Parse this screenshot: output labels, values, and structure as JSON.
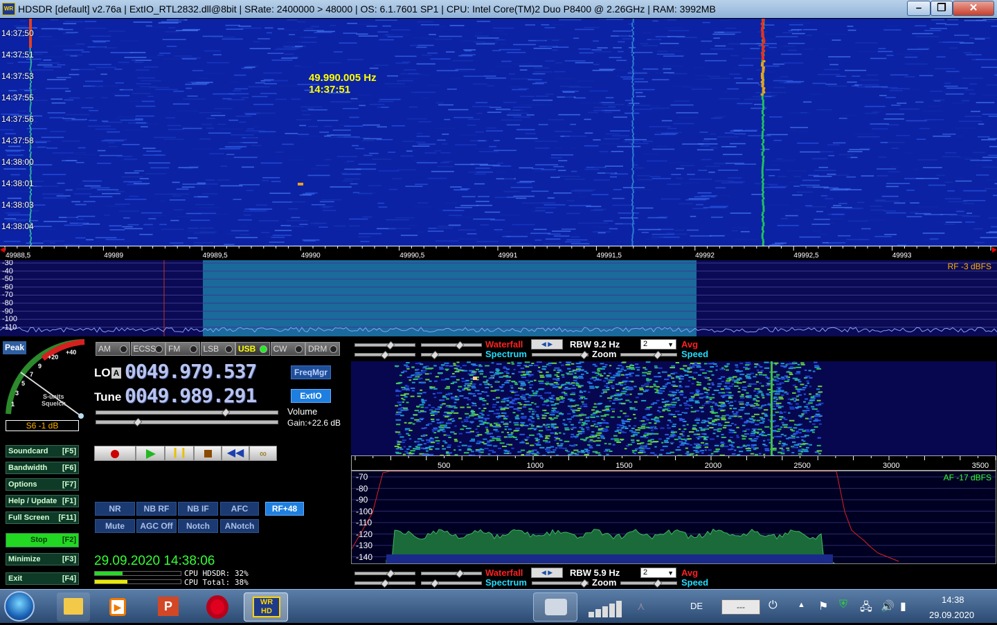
{
  "titlebar": {
    "text": "HDSDR  [default]  v2.76a   |  ExtIO_RTL2832.dll@8bit  |  SRate: 2400000 > 48000  |  OS: 6.1.7601 SP1  |  CPU: Intel Core(TM)2 Duo       P8400  @ 2.26GHz  |  RAM: 3992MB",
    "minimize": "–",
    "maximize": "❐",
    "close": "✕"
  },
  "waterfall": {
    "timestamps": [
      "14:37:50",
      "14:37:51",
      "14:37:53",
      "14:37:55",
      "14:37:56",
      "14:37:58",
      "14:38:00",
      "14:38:01",
      "14:38:03",
      "14:38:04"
    ],
    "cursor_freq": "49.990.005 Hz",
    "cursor_time": "14:37:51"
  },
  "freq_axis": [
    "49988,5",
    "49989",
    "49989,5",
    "49990",
    "49990,5",
    "49991",
    "49991,5",
    "49992",
    "49992,5",
    "49993"
  ],
  "rf_spectrum": {
    "db_labels": [
      "-30",
      "-40",
      "-50",
      "-60",
      "-70",
      "-80",
      "-90",
      "-100",
      "-110"
    ],
    "level": "RF  -3 dBFS"
  },
  "smeter": {
    "peak": "Peak",
    "scale": [
      "+40",
      "+20",
      "9",
      "7",
      "5",
      "3",
      "1"
    ],
    "sunits": "S-units",
    "squelch": "Squelch",
    "readout": "S6 -1 dB"
  },
  "modes": [
    {
      "label": "AM",
      "active": false
    },
    {
      "label": "ECSS",
      "active": false
    },
    {
      "label": "FM",
      "active": false
    },
    {
      "label": "LSB",
      "active": false
    },
    {
      "label": "USB",
      "active": true
    },
    {
      "label": "CW",
      "active": false
    },
    {
      "label": "DRM",
      "active": false
    }
  ],
  "lo": {
    "label": "LO",
    "badge": "A",
    "value": "0049.979.537"
  },
  "tune": {
    "label": "Tune",
    "value": "0049.989.291"
  },
  "freqmgr": "FreqMgr",
  "extio": "ExtIO",
  "volume": {
    "label": "Volume",
    "gain": "Gain:+22.6 dB"
  },
  "nav": [
    {
      "label": "Soundcard",
      "key": "[F5]",
      "name": "soundcard-button"
    },
    {
      "label": "Bandwidth",
      "key": "[F6]",
      "name": "bandwidth-button"
    },
    {
      "label": "Options",
      "key": "[F7]",
      "name": "options-button"
    },
    {
      "label": "Help / Update",
      "key": "[F1]",
      "name": "help-update-button"
    },
    {
      "label": "Full Screen",
      "key": "[F11]",
      "name": "full-screen-button"
    },
    {
      "label": "Stop",
      "key": "[F2]",
      "name": "stop-button"
    },
    {
      "label": "Minimize",
      "key": "[F3]",
      "name": "minimize-app-button"
    },
    {
      "label": "Exit",
      "key": "[F4]",
      "name": "exit-button"
    }
  ],
  "dsp": {
    "row1": [
      "NR",
      "NB RF",
      "NB IF",
      "AFC"
    ],
    "row2": [
      "Mute",
      "AGC Off",
      "Notch",
      "ANotch"
    ],
    "rf_offset": "RF+48"
  },
  "status": {
    "datetime": "29.09.2020 14:38:06",
    "cpu_hdsdr": "CPU HDSDR: 32%",
    "cpu_total": "CPU Total: 38%",
    "cpu_hdsdr_pct": 32,
    "cpu_total_pct": 38
  },
  "top_ctrl": {
    "waterfall": "Waterfall",
    "spectrum": "Spectrum",
    "rbw": "RBW  9.2 Hz",
    "zoom": "Zoom",
    "combo": "2",
    "avg": "Avg",
    "speed": "Speed"
  },
  "bottom_ctrl": {
    "waterfall": "Waterfall",
    "spectrum": "Spectrum",
    "rbw": "RBW  5.9 Hz",
    "zoom": "Zoom",
    "combo": "2",
    "avg": "Avg",
    "speed": "Speed"
  },
  "af_axis": [
    "500",
    "1000",
    "1500",
    "2000",
    "2500",
    "3000",
    "3500"
  ],
  "af_spectrum": {
    "db_labels": [
      "-70",
      "-80",
      "-90",
      "-100",
      "-110",
      "-120",
      "-130",
      "-140"
    ],
    "level": "AF  -17 dBFS"
  },
  "taskbar": {
    "lang": "DE",
    "battery": "---",
    "time": "14:38",
    "date": "29.09.2020",
    "hdsdr_label": "WR HD"
  },
  "colors": {
    "waterfall_bg": "#0c22a4",
    "passband": "#1a6a9c",
    "accent_green": "#33ff33",
    "accent_yellow": "#ffff00"
  }
}
